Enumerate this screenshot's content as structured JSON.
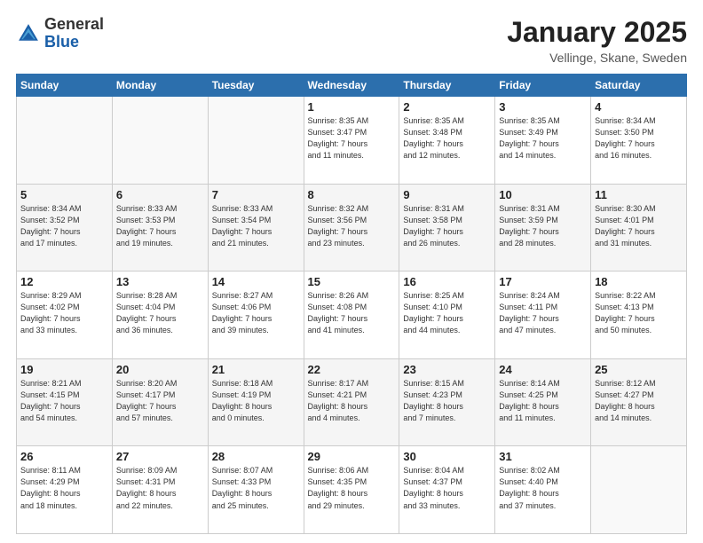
{
  "header": {
    "logo_general": "General",
    "logo_blue": "Blue",
    "month_title": "January 2025",
    "location": "Vellinge, Skane, Sweden"
  },
  "days_of_week": [
    "Sunday",
    "Monday",
    "Tuesday",
    "Wednesday",
    "Thursday",
    "Friday",
    "Saturday"
  ],
  "weeks": [
    [
      {
        "day": "",
        "info": ""
      },
      {
        "day": "",
        "info": ""
      },
      {
        "day": "",
        "info": ""
      },
      {
        "day": "1",
        "info": "Sunrise: 8:35 AM\nSunset: 3:47 PM\nDaylight: 7 hours\nand 11 minutes."
      },
      {
        "day": "2",
        "info": "Sunrise: 8:35 AM\nSunset: 3:48 PM\nDaylight: 7 hours\nand 12 minutes."
      },
      {
        "day": "3",
        "info": "Sunrise: 8:35 AM\nSunset: 3:49 PM\nDaylight: 7 hours\nand 14 minutes."
      },
      {
        "day": "4",
        "info": "Sunrise: 8:34 AM\nSunset: 3:50 PM\nDaylight: 7 hours\nand 16 minutes."
      }
    ],
    [
      {
        "day": "5",
        "info": "Sunrise: 8:34 AM\nSunset: 3:52 PM\nDaylight: 7 hours\nand 17 minutes."
      },
      {
        "day": "6",
        "info": "Sunrise: 8:33 AM\nSunset: 3:53 PM\nDaylight: 7 hours\nand 19 minutes."
      },
      {
        "day": "7",
        "info": "Sunrise: 8:33 AM\nSunset: 3:54 PM\nDaylight: 7 hours\nand 21 minutes."
      },
      {
        "day": "8",
        "info": "Sunrise: 8:32 AM\nSunset: 3:56 PM\nDaylight: 7 hours\nand 23 minutes."
      },
      {
        "day": "9",
        "info": "Sunrise: 8:31 AM\nSunset: 3:58 PM\nDaylight: 7 hours\nand 26 minutes."
      },
      {
        "day": "10",
        "info": "Sunrise: 8:31 AM\nSunset: 3:59 PM\nDaylight: 7 hours\nand 28 minutes."
      },
      {
        "day": "11",
        "info": "Sunrise: 8:30 AM\nSunset: 4:01 PM\nDaylight: 7 hours\nand 31 minutes."
      }
    ],
    [
      {
        "day": "12",
        "info": "Sunrise: 8:29 AM\nSunset: 4:02 PM\nDaylight: 7 hours\nand 33 minutes."
      },
      {
        "day": "13",
        "info": "Sunrise: 8:28 AM\nSunset: 4:04 PM\nDaylight: 7 hours\nand 36 minutes."
      },
      {
        "day": "14",
        "info": "Sunrise: 8:27 AM\nSunset: 4:06 PM\nDaylight: 7 hours\nand 39 minutes."
      },
      {
        "day": "15",
        "info": "Sunrise: 8:26 AM\nSunset: 4:08 PM\nDaylight: 7 hours\nand 41 minutes."
      },
      {
        "day": "16",
        "info": "Sunrise: 8:25 AM\nSunset: 4:10 PM\nDaylight: 7 hours\nand 44 minutes."
      },
      {
        "day": "17",
        "info": "Sunrise: 8:24 AM\nSunset: 4:11 PM\nDaylight: 7 hours\nand 47 minutes."
      },
      {
        "day": "18",
        "info": "Sunrise: 8:22 AM\nSunset: 4:13 PM\nDaylight: 7 hours\nand 50 minutes."
      }
    ],
    [
      {
        "day": "19",
        "info": "Sunrise: 8:21 AM\nSunset: 4:15 PM\nDaylight: 7 hours\nand 54 minutes."
      },
      {
        "day": "20",
        "info": "Sunrise: 8:20 AM\nSunset: 4:17 PM\nDaylight: 7 hours\nand 57 minutes."
      },
      {
        "day": "21",
        "info": "Sunrise: 8:18 AM\nSunset: 4:19 PM\nDaylight: 8 hours\nand 0 minutes."
      },
      {
        "day": "22",
        "info": "Sunrise: 8:17 AM\nSunset: 4:21 PM\nDaylight: 8 hours\nand 4 minutes."
      },
      {
        "day": "23",
        "info": "Sunrise: 8:15 AM\nSunset: 4:23 PM\nDaylight: 8 hours\nand 7 minutes."
      },
      {
        "day": "24",
        "info": "Sunrise: 8:14 AM\nSunset: 4:25 PM\nDaylight: 8 hours\nand 11 minutes."
      },
      {
        "day": "25",
        "info": "Sunrise: 8:12 AM\nSunset: 4:27 PM\nDaylight: 8 hours\nand 14 minutes."
      }
    ],
    [
      {
        "day": "26",
        "info": "Sunrise: 8:11 AM\nSunset: 4:29 PM\nDaylight: 8 hours\nand 18 minutes."
      },
      {
        "day": "27",
        "info": "Sunrise: 8:09 AM\nSunset: 4:31 PM\nDaylight: 8 hours\nand 22 minutes."
      },
      {
        "day": "28",
        "info": "Sunrise: 8:07 AM\nSunset: 4:33 PM\nDaylight: 8 hours\nand 25 minutes."
      },
      {
        "day": "29",
        "info": "Sunrise: 8:06 AM\nSunset: 4:35 PM\nDaylight: 8 hours\nand 29 minutes."
      },
      {
        "day": "30",
        "info": "Sunrise: 8:04 AM\nSunset: 4:37 PM\nDaylight: 8 hours\nand 33 minutes."
      },
      {
        "day": "31",
        "info": "Sunrise: 8:02 AM\nSunset: 4:40 PM\nDaylight: 8 hours\nand 37 minutes."
      },
      {
        "day": "",
        "info": ""
      }
    ]
  ]
}
